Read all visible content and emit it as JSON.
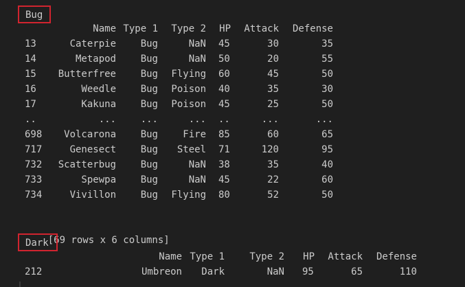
{
  "groups": [
    {
      "label": "Bug",
      "columns": [
        "Name",
        "Type 1",
        "Type 2",
        "HP",
        "Attack",
        "Defense"
      ],
      "rows": [
        {
          "index": "13",
          "name": "Caterpie",
          "type1": "Bug",
          "type2": "NaN",
          "hp": "45",
          "attack": "30",
          "defense": "35"
        },
        {
          "index": "14",
          "name": "Metapod",
          "type1": "Bug",
          "type2": "NaN",
          "hp": "50",
          "attack": "20",
          "defense": "55"
        },
        {
          "index": "15",
          "name": "Butterfree",
          "type1": "Bug",
          "type2": "Flying",
          "hp": "60",
          "attack": "45",
          "defense": "50"
        },
        {
          "index": "16",
          "name": "Weedle",
          "type1": "Bug",
          "type2": "Poison",
          "hp": "40",
          "attack": "35",
          "defense": "30"
        },
        {
          "index": "17",
          "name": "Kakuna",
          "type1": "Bug",
          "type2": "Poison",
          "hp": "45",
          "attack": "25",
          "defense": "50"
        },
        {
          "index": "..",
          "name": "...",
          "type1": "...",
          "type2": "...",
          "hp": "..",
          "attack": "...",
          "defense": "..."
        },
        {
          "index": "698",
          "name": "Volcarona",
          "type1": "Bug",
          "type2": "Fire",
          "hp": "85",
          "attack": "60",
          "defense": "65"
        },
        {
          "index": "717",
          "name": "Genesect",
          "type1": "Bug",
          "type2": "Steel",
          "hp": "71",
          "attack": "120",
          "defense": "95"
        },
        {
          "index": "732",
          "name": "Scatterbug",
          "type1": "Bug",
          "type2": "NaN",
          "hp": "38",
          "attack": "35",
          "defense": "40"
        },
        {
          "index": "733",
          "name": "Spewpa",
          "type1": "Bug",
          "type2": "NaN",
          "hp": "45",
          "attack": "22",
          "defense": "60"
        },
        {
          "index": "734",
          "name": "Vivillon",
          "type1": "Bug",
          "type2": "Flying",
          "hp": "80",
          "attack": "52",
          "defense": "50"
        }
      ],
      "summary": "[69 rows x 6 columns]"
    },
    {
      "label": "Dark",
      "columns": [
        "Name",
        "Type 1",
        "Type 2",
        "HP",
        "Attack",
        "Defense"
      ],
      "rows": [
        {
          "index": "212",
          "name": "Umbreon",
          "type1": "Dark",
          "type2": "NaN",
          "hp": "95",
          "attack": "65",
          "defense": "110"
        }
      ]
    }
  ],
  "colors": {
    "background": "#1f1f1f",
    "text": "#cccccc",
    "highlight_box": "#d1242f"
  }
}
